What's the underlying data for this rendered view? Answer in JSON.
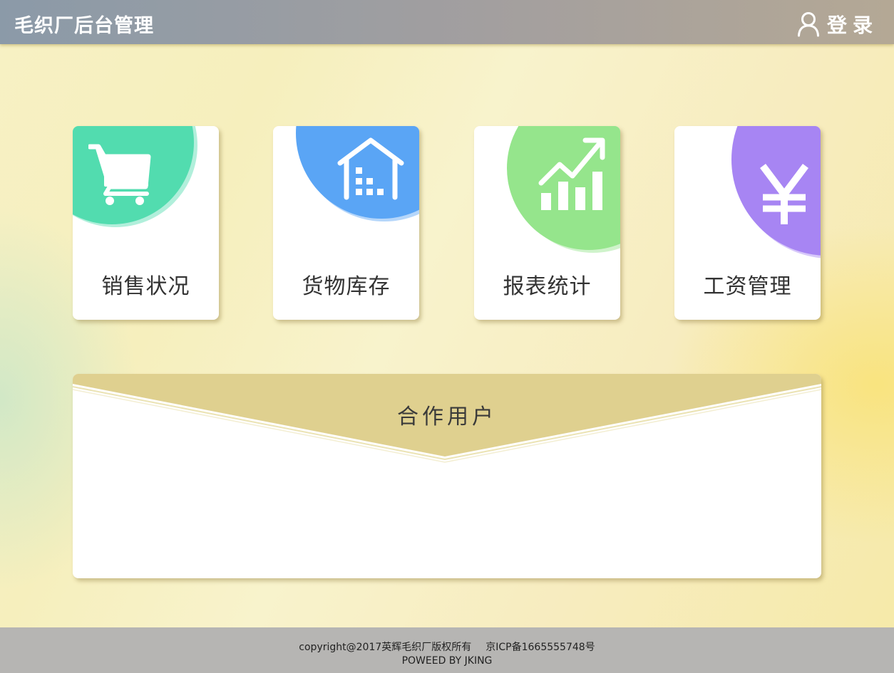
{
  "header": {
    "title": "毛织厂后台管理",
    "login_label": "登录",
    "login_icon": "user-icon"
  },
  "cards": [
    {
      "label": "销售状况",
      "icon": "shopping-cart-icon",
      "color": "#52dcaf"
    },
    {
      "label": "货物库存",
      "icon": "warehouse-icon",
      "color": "#5aa5f5"
    },
    {
      "label": "报表统计",
      "icon": "growth-chart-icon",
      "color": "#95e58c"
    },
    {
      "label": "工资管理",
      "icon": "yen-icon",
      "color": "#a785f3"
    }
  ],
  "partners": {
    "title": "合作用户",
    "banner_color": "#dfd08f"
  },
  "footer": {
    "copyright": "copyright@2017英辉毛织厂版权所有",
    "icp": "京ICP备1665555748号",
    "powered": "POWEED BY JKING"
  }
}
